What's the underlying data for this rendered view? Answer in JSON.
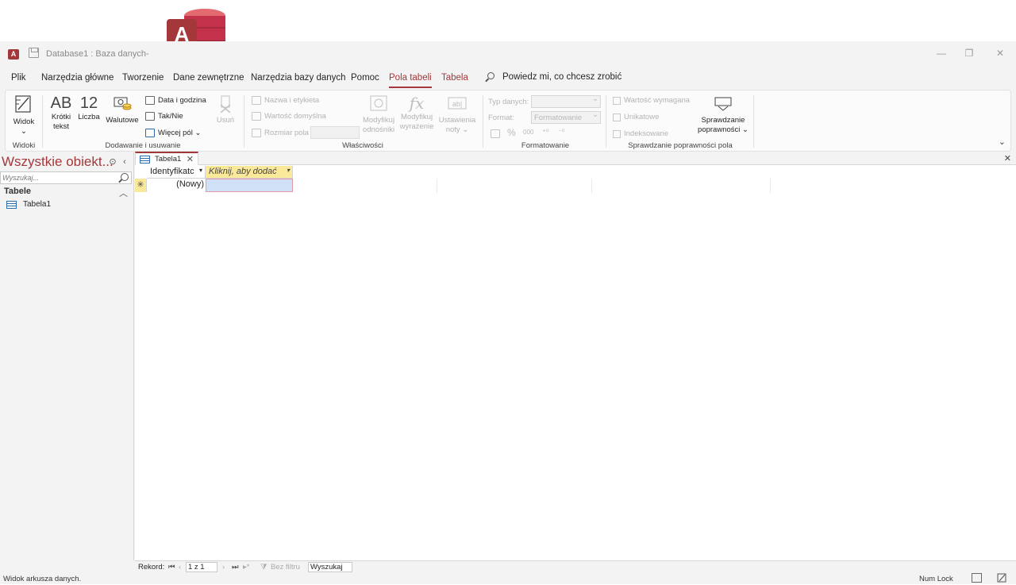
{
  "window": {
    "title": "Database1 : Baza danych-",
    "logo_letter": "A",
    "app_icon_letter": "A",
    "minimize": "—",
    "restore": "❐",
    "close": "✕"
  },
  "menu": {
    "items": [
      "Plik",
      "Narzędzia główne",
      "Tworzenie",
      "Dane zewnętrzne",
      "Narzędzia bazy danych",
      "Pomoc",
      "Pola tabeli",
      "Tabela"
    ],
    "active": "Pola tabeli",
    "tell_me": "Powiedz mi, co chcesz zrobić"
  },
  "ribbon": {
    "widoki": {
      "label": "Widoki",
      "widok_btn": "Widok",
      "chev": "⌄"
    },
    "dodawanie": {
      "label": "Dodawanie i usuwanie",
      "krotki_glyph": "AB",
      "krotki_l1": "Krótki",
      "krotki_l2": "tekst",
      "liczba_glyph": "12",
      "liczba": "Liczba",
      "walutowe": "Walutowe",
      "data": "Data i godzina",
      "taknie": "Tak/Nie",
      "wiecej": "Więcej pól ⌄",
      "usun": "Usuń"
    },
    "wlasciwosci": {
      "label": "Właściwości",
      "nazwa": "Nazwa i etykieta",
      "wartosc": "Wartość domyślna",
      "rozmiar": "Rozmiar pola",
      "mod_odn_l1": "Modyfikuj",
      "mod_odn_l2": "odnośniki",
      "mod_wyr_l1": "Modyfikuj",
      "mod_wyr_l2": "wyrażenie",
      "ust_l1": "Ustawienia",
      "ust_l2": "noty ⌄"
    },
    "formatowanie": {
      "label": "Formatowanie",
      "typ": "Typ danych:",
      "format": "Format:",
      "format_value": "Formatowanie",
      "pct": "%",
      "thousands": "000"
    },
    "sprawdzanie": {
      "label": "Sprawdzanie poprawności pola",
      "wymagana": "Wartość wymagana",
      "unikatowe": "Unikatowe",
      "indeksowane": "Indeksowane",
      "btn_l1": "Sprawdzanie",
      "btn_l2": "poprawności ⌄"
    }
  },
  "nav": {
    "title": "Wszystkie obiekt...",
    "search_placeholder": "Wyszukaj...",
    "section": "Tabele",
    "items": [
      "Tabela1"
    ]
  },
  "document": {
    "tab": "Tabela1",
    "columns": [
      "Identyfikatc",
      "Kliknij, aby dodać"
    ],
    "new_row_marker": "✳",
    "new_row_value": "(Nowy)"
  },
  "record_nav": {
    "label": "Rekord:",
    "position": "1 z 1",
    "filter": "Bez filtru",
    "search": "Wyszukaj"
  },
  "status": {
    "left": "Widok arkusza danych.",
    "numlock": "Num Lock"
  }
}
